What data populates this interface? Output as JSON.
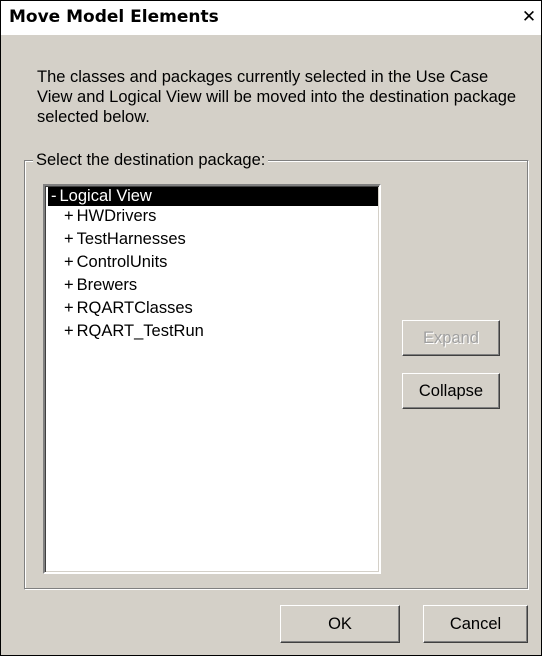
{
  "window": {
    "title": "Move Model Elements",
    "close_glyph": "✕"
  },
  "description": "The classes and packages currently selected in the Use Case View and Logical View will be moved into the destination package selected below.",
  "group": {
    "legend": "Select the destination package:"
  },
  "tree": {
    "root": {
      "marker": "-",
      "label": "Logical View",
      "selected": true
    },
    "children": [
      {
        "marker": "+",
        "label": "HWDrivers"
      },
      {
        "marker": "+",
        "label": "TestHarnesses"
      },
      {
        "marker": "+",
        "label": "ControlUnits"
      },
      {
        "marker": "+",
        "label": "Brewers"
      },
      {
        "marker": "+",
        "label": "RQARTClasses"
      },
      {
        "marker": "+",
        "label": "RQART_TestRun"
      }
    ]
  },
  "buttons": {
    "expand": {
      "label": "Expand",
      "enabled": false
    },
    "collapse": {
      "label": "Collapse",
      "enabled": true
    },
    "ok": {
      "label": "OK",
      "enabled": true
    },
    "cancel": {
      "label": "Cancel",
      "enabled": true
    }
  },
  "colors": {
    "dialog_bg": "#d4d0c8",
    "selection_bg": "#000000",
    "selection_fg": "#ffffff",
    "disabled_text": "#a0a0a0"
  }
}
